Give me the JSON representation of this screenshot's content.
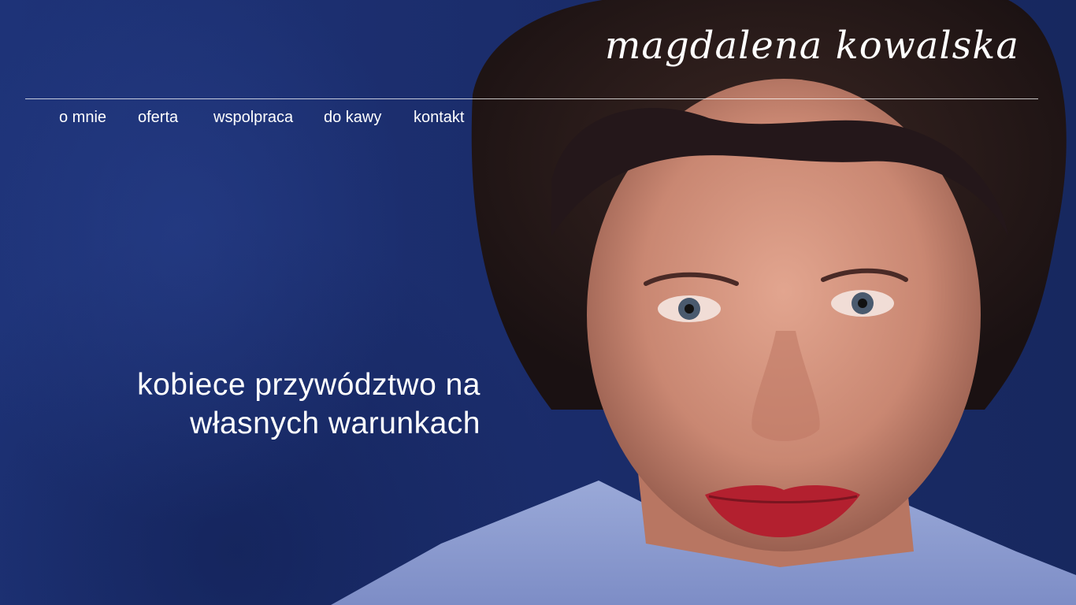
{
  "brand": {
    "name": "magdalena kowalska"
  },
  "nav": {
    "items": [
      {
        "label": "o mnie"
      },
      {
        "label": "oferta"
      },
      {
        "label": "wspolpraca"
      },
      {
        "label": "do kawy"
      },
      {
        "label": "kontakt"
      }
    ]
  },
  "hero": {
    "headline_line1": "kobiece przywództwo na",
    "headline_line2": "własnych warunkach",
    "background_color": "#1d2f6f",
    "lip_color": "#b3202f"
  }
}
